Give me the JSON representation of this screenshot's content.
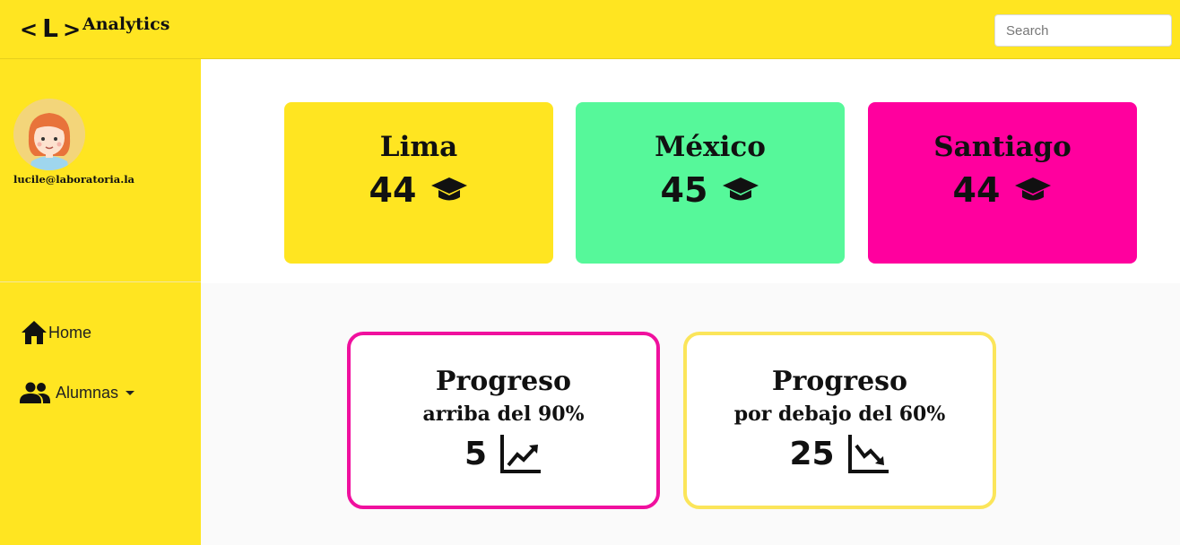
{
  "header": {
    "logo_left": "<",
    "logo_letter": "L",
    "logo_right": ">",
    "title": "Analytics",
    "search_placeholder": "Search"
  },
  "sidebar": {
    "email": "lucile@laboratoria.la",
    "nav": [
      {
        "label": "Home",
        "icon": "home-icon"
      },
      {
        "label": "Alumnas",
        "icon": "people-icon"
      }
    ]
  },
  "cities": [
    {
      "name": "Lima",
      "value": "44",
      "color": "#ffe521",
      "icon": "graduation-cap-icon"
    },
    {
      "name": "México",
      "value": "45",
      "color": "#56f89a",
      "icon": "graduation-cap-icon"
    },
    {
      "name": "Santiago",
      "value": "44",
      "color": "#ff009e",
      "icon": "graduation-cap-icon"
    }
  ],
  "progress": [
    {
      "title": "Progreso",
      "subtitle": "arriba del 90%",
      "value": "5",
      "border": "#f0109e",
      "icon": "trending-up-icon"
    },
    {
      "title": "Progreso",
      "subtitle": "por debajo del 60%",
      "value": "25",
      "border": "#fbe55a",
      "icon": "trending-down-icon"
    }
  ]
}
